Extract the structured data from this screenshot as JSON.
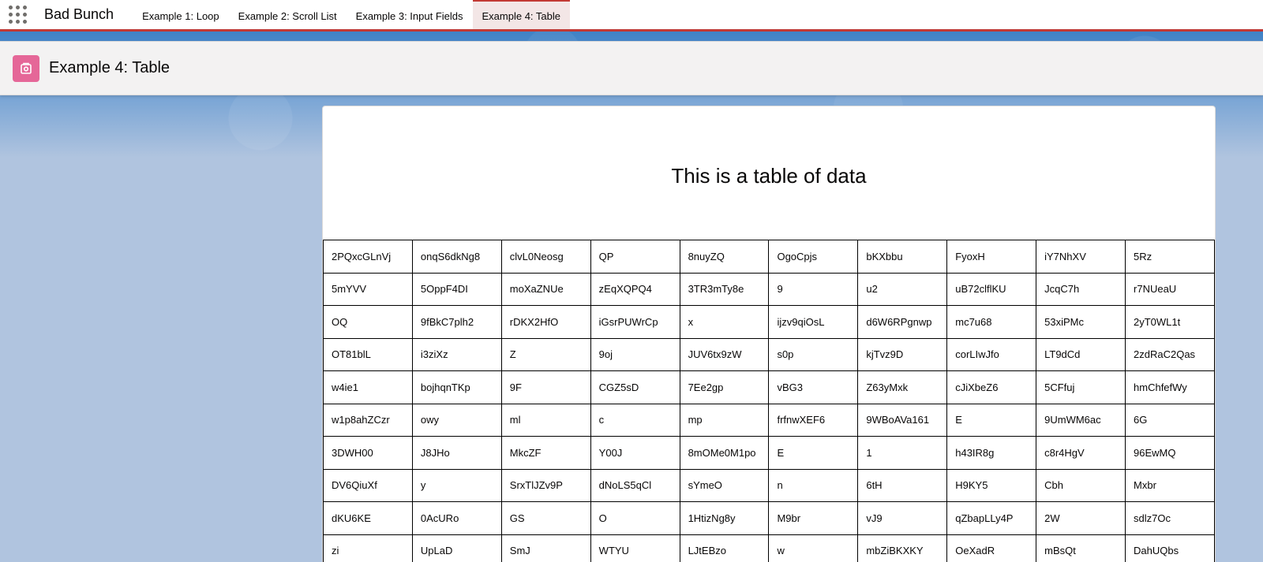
{
  "nav": {
    "app_name": "Bad Bunch",
    "tabs": [
      {
        "label": "Example 1: Loop"
      },
      {
        "label": "Example 2: Scroll List"
      },
      {
        "label": "Example 3: Input Fields"
      },
      {
        "label": "Example 4: Table",
        "active": true
      }
    ],
    "launcher_icon": "app-launcher-waffle-icon",
    "accent_color": "#c23934"
  },
  "header": {
    "title": "Example 4: Table",
    "icon": "lightning-page-icon",
    "icon_color": "#e56798"
  },
  "card": {
    "title": "This is a table of data"
  },
  "table": {
    "rows": [
      [
        "2PQxcGLnVj",
        "onqS6dkNg8",
        "clvL0Neosg",
        "QP",
        "8nuyZQ",
        "OgoCpjs",
        "bKXbbu",
        "FyoxH",
        "iY7NhXV",
        "5Rz"
      ],
      [
        "5mYVV",
        "5OppF4DI",
        "moXaZNUe",
        "zEqXQPQ4",
        "3TR3mTy8e",
        "9",
        "u2",
        "uB72clflKU",
        "JcqC7h",
        "r7NUeaU"
      ],
      [
        "OQ",
        "9fBkC7plh2",
        "rDKX2HfO",
        "iGsrPUWrCp",
        "x",
        "ijzv9qiOsL",
        "d6W6RPgnwp",
        "mc7u68",
        "53xiPMc",
        "2yT0WL1t"
      ],
      [
        "OT81blL",
        "i3ziXz",
        "Z",
        "9oj",
        "JUV6tx9zW",
        "s0p",
        "kjTvz9D",
        "corLIwJfo",
        "LT9dCd",
        "2zdRaC2Qas"
      ],
      [
        "w4ie1",
        "bojhqnTKp",
        "9F",
        "CGZ5sD",
        "7Ee2gp",
        "vBG3",
        "Z63yMxk",
        "cJiXbeZ6",
        "5CFfuj",
        "hmChfefWy"
      ],
      [
        "w1p8ahZCzr",
        "owy",
        "ml",
        "c",
        "mp",
        "frfnwXEF6",
        "9WBoAVa161",
        "E",
        "9UmWM6ac",
        "6G"
      ],
      [
        "3DWH00",
        "J8JHo",
        "MkcZF",
        "Y00J",
        "8mOMe0M1po",
        "E",
        "1",
        "h43IR8g",
        "c8r4HgV",
        "96EwMQ"
      ],
      [
        "DV6QiuXf",
        "y",
        "SrxTlJZv9P",
        "dNoLS5qCl",
        "sYmeO",
        "n",
        "6tH",
        "H9KY5",
        "Cbh",
        "Mxbr"
      ],
      [
        "dKU6KE",
        "0AcURo",
        "GS",
        "O",
        "1HtizNg8y",
        "M9br",
        "vJ9",
        "qZbapLLy4P",
        "2W",
        "sdlz7Oc"
      ],
      [
        "zi",
        "UpLaD",
        "SmJ",
        "WTYU",
        "LJtEBzo",
        "w",
        "mbZiBKXKY",
        "OeXadR",
        "mBsQt",
        "DahUQbs"
      ]
    ]
  }
}
